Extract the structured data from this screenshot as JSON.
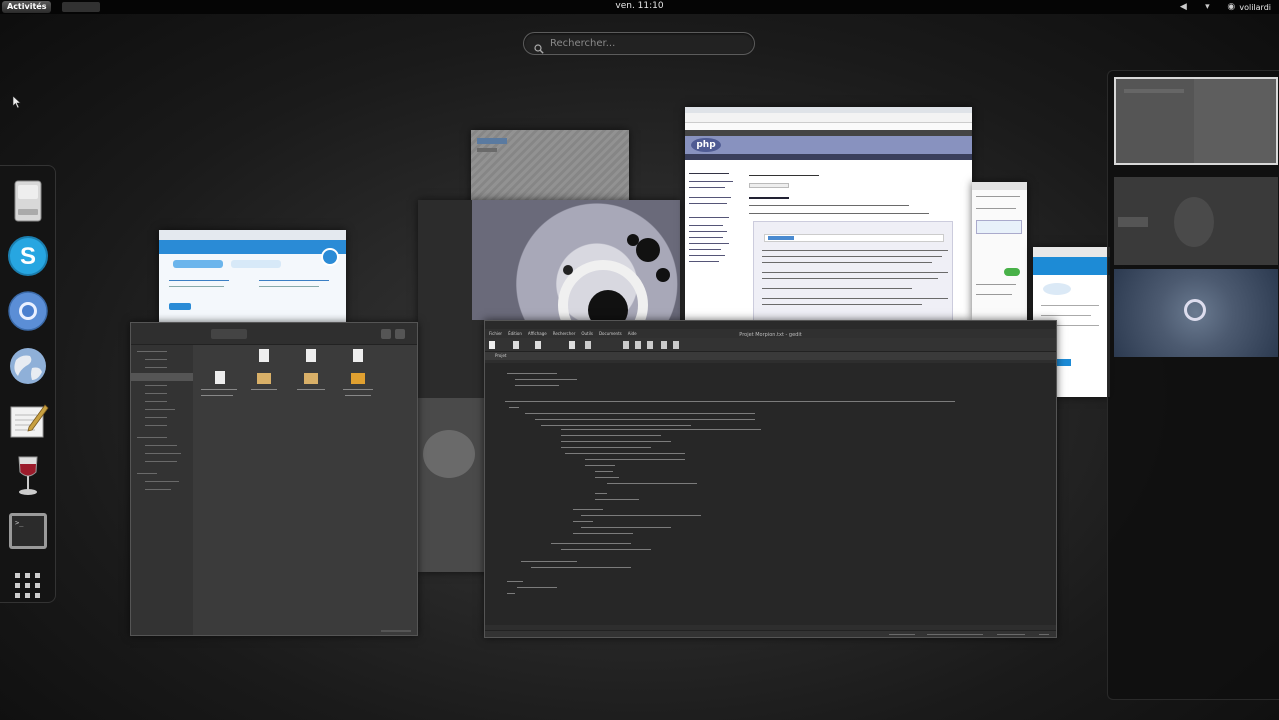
{
  "topbar": {
    "activities_label": "Activités",
    "clock": "ven. 11:10",
    "user_name": "volilardi"
  },
  "search": {
    "placeholder": "Rechercher..."
  },
  "dash": {
    "items": [
      {
        "name": "files-app",
        "icon": "drive-icon"
      },
      {
        "name": "skype-app",
        "icon": "skype-icon"
      },
      {
        "name": "chromium-app",
        "icon": "chromium-icon"
      },
      {
        "name": "web-browser-app",
        "icon": "globe-icon"
      },
      {
        "name": "text-editor-app",
        "icon": "text-editor-icon"
      },
      {
        "name": "wine-app",
        "icon": "wine-glass-icon"
      },
      {
        "name": "terminal-app",
        "icon": "terminal-icon"
      },
      {
        "name": "show-applications",
        "icon": "grid-icon"
      }
    ]
  },
  "windows": {
    "editor": {
      "title": "Projet Morpion.txt - gedit",
      "menu": [
        "Fichier",
        "Édition",
        "Affichage",
        "Rechercher",
        "Outils",
        "Documents",
        "Aide"
      ],
      "tab": "Projet"
    },
    "browser": {
      "logo": "php"
    },
    "file_manager": {
      "files": [
        "",
        "",
        "",
        "",
        "",
        "",
        "",
        ""
      ]
    }
  },
  "colors": {
    "accent_blue": "#2a8bd6",
    "php_purple": "#8892bf",
    "background_dark": "#1e1e1e"
  }
}
